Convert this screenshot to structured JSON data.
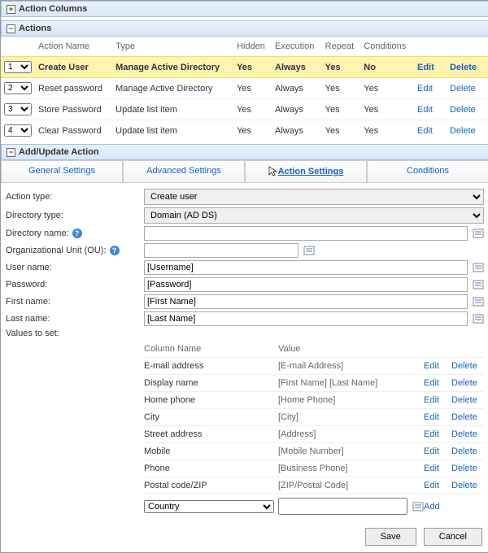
{
  "sections": {
    "action_columns": "Action Columns",
    "actions": "Actions",
    "add_update": "Add/Update Action",
    "toggle_plus": "+",
    "toggle_minus": "−"
  },
  "actions_table": {
    "headers": [
      "",
      "Action Name",
      "Type",
      "Hidden",
      "Execution",
      "Repeat",
      "Conditions",
      "",
      ""
    ],
    "rows": [
      {
        "order": "1",
        "name": "Create User",
        "type": "Manage Active Directory",
        "hidden": "Yes",
        "execution": "Always",
        "repeat": "Yes",
        "conditions": "No",
        "selected": true
      },
      {
        "order": "2",
        "name": "Reset password",
        "type": "Manage Active Directory",
        "hidden": "Yes",
        "execution": "Always",
        "repeat": "Yes",
        "conditions": "Yes",
        "selected": false
      },
      {
        "order": "3",
        "name": "Store Password",
        "type": "Update list item",
        "hidden": "Yes",
        "execution": "Always",
        "repeat": "Yes",
        "conditions": "Yes",
        "selected": false
      },
      {
        "order": "4",
        "name": "Clear Password",
        "type": "Update list item",
        "hidden": "Yes",
        "execution": "Always",
        "repeat": "Yes",
        "conditions": "Yes",
        "selected": false
      }
    ],
    "edit": "Edit",
    "delete": "Delete"
  },
  "tabs": {
    "general": "General Settings",
    "advanced": "Advanced Settings",
    "action": "Action Settings",
    "conditions": "Conditions"
  },
  "form": {
    "action_type_label": "Action type:",
    "action_type_value": "Create user",
    "directory_type_label": "Directory type:",
    "directory_type_value": "Domain (AD DS)",
    "directory_name_label": "Directory name:",
    "directory_name_value": "",
    "ou_label": "Organizational Unit (OU):",
    "ou_value": "",
    "user_name_label": "User name:",
    "user_name_value": "[Username]",
    "password_label": "Password:",
    "password_value": "[Password]",
    "first_name_label": "First name:",
    "first_name_value": "[First Name]",
    "last_name_label": "Last name:",
    "last_name_value": "[Last Name]",
    "values_to_set_label": "Values to set:"
  },
  "values": {
    "col_name": "Column Name",
    "col_value": "Value",
    "edit": "Edit",
    "delete": "Delete",
    "add": "Add",
    "rows": [
      {
        "name": "E-mail address",
        "value": "[E-mail Address]"
      },
      {
        "name": "Display name",
        "value": "[First Name] [Last Name]"
      },
      {
        "name": "Home phone",
        "value": "[Home Phone]"
      },
      {
        "name": "City",
        "value": "[City]"
      },
      {
        "name": "Street address",
        "value": "[Address]"
      },
      {
        "name": "Mobile",
        "value": "[Mobile Number]"
      },
      {
        "name": "Phone",
        "value": "[Business Phone]"
      },
      {
        "name": "Postal code/ZIP",
        "value": "[ZIP/Postal Code]"
      }
    ],
    "add_column": "Country",
    "add_value": ""
  },
  "footer": {
    "save": "Save",
    "cancel": "Cancel"
  }
}
